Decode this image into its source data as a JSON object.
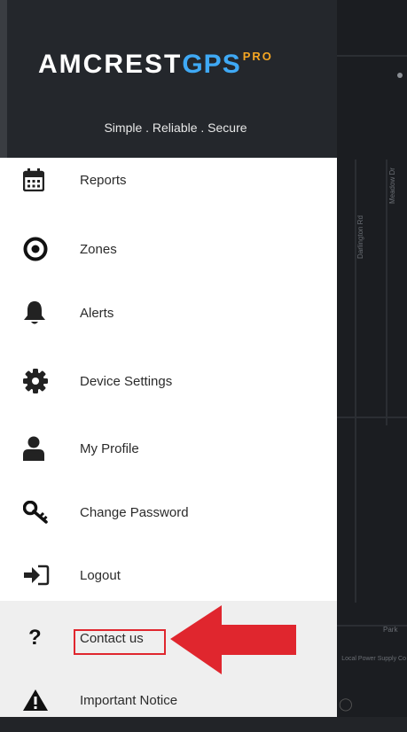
{
  "logo": {
    "brand": "AMCREST",
    "gps": "GPS",
    "pro": "PRO"
  },
  "tagline": "Simple . Reliable . Secure",
  "menu": {
    "items": [
      {
        "label": "Reports",
        "icon": "calendar-icon"
      },
      {
        "label": "Zones",
        "icon": "target-icon"
      },
      {
        "label": "Alerts",
        "icon": "bell-icon"
      },
      {
        "label": "Device Settings",
        "icon": "gear-icon"
      },
      {
        "label": "My Profile",
        "icon": "person-icon"
      },
      {
        "label": "Change Password",
        "icon": "key-icon"
      },
      {
        "label": "Logout",
        "icon": "sign-in-icon"
      },
      {
        "label": "Contact us",
        "icon": "question-icon"
      },
      {
        "label": "Important Notice",
        "icon": "warning-icon"
      }
    ]
  },
  "map": {
    "streets": [
      "Darlington Rd",
      "Meadow Dr",
      "Park"
    ],
    "poi": "Local Power Supply Co"
  },
  "colors": {
    "header_bg": "#24272c",
    "accent_blue": "#3fa9f5",
    "accent_orange": "#f5a623",
    "highlight_red": "#e0262e"
  }
}
